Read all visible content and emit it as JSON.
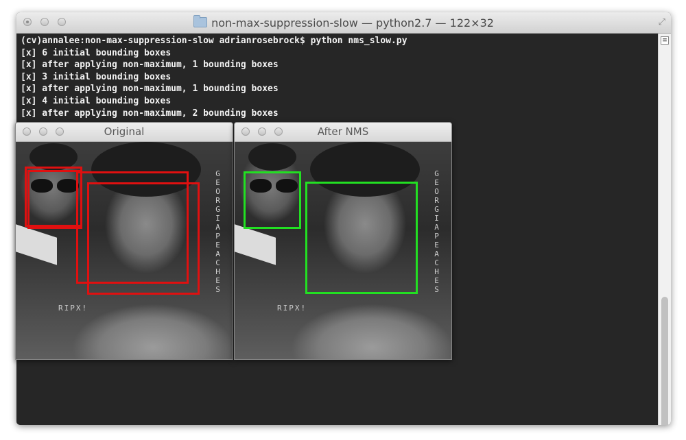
{
  "terminal": {
    "title": "non-max-suppression-slow — python2.7 — 122×32",
    "lines": [
      "(cv)annalee:non-max-suppression-slow adrianrosebrock$ python nms_slow.py",
      "[x] 6 initial bounding boxes",
      "[x] after applying non-maximum, 1 bounding boxes",
      "[x] 3 initial bounding boxes",
      "[x] after applying non-maximum, 1 bounding boxes",
      "[x] 4 initial bounding boxes",
      "[x] after applying non-maximum, 2 bounding boxes"
    ]
  },
  "windows": {
    "original": {
      "title": "Original",
      "box_color": "#e01010"
    },
    "after_nms": {
      "title": "After NMS",
      "box_color": "#22e022"
    }
  },
  "photo_text": {
    "side": "GEORGIA PEACHES",
    "shirt": "RIPX!"
  },
  "icons": {
    "folder": "folder-icon",
    "resize": "fullscreen-icon",
    "scroll_menu": "scroll-menu-icon"
  }
}
